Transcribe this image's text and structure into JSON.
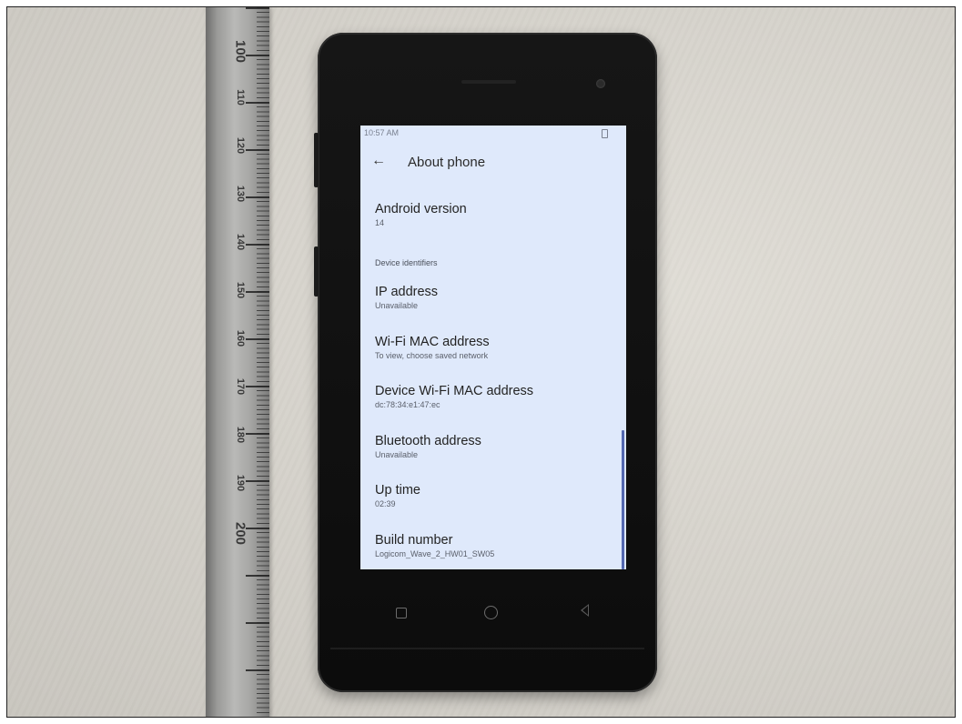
{
  "ruler": {
    "marks": [
      "100",
      "110",
      "120",
      "130",
      "140",
      "150",
      "160",
      "170",
      "180",
      "190",
      "200"
    ]
  },
  "status_bar": {
    "time": "10:57 AM",
    "battery_icon": "battery-icon"
  },
  "app_bar": {
    "title": "About phone",
    "back_icon": "arrow-left-icon"
  },
  "preferences": [
    {
      "title": "Android version",
      "summary": "14"
    },
    {
      "section": "Device identifiers"
    },
    {
      "title": "IP address",
      "summary": "Unavailable"
    },
    {
      "title": "Wi-Fi MAC address",
      "summary": "To view, choose saved network"
    },
    {
      "title": "Device Wi-Fi MAC address",
      "summary": "dc:78:34:e1:47:ec"
    },
    {
      "title": "Bluetooth address",
      "summary": "Unavailable"
    },
    {
      "title": "Up time",
      "summary": "02:39"
    },
    {
      "title": "Build number",
      "summary": "Logicom_Wave_2_HW01_SW05"
    }
  ],
  "navigation": [
    "recents-square-icon",
    "home-circle-icon",
    "back-triangle-icon"
  ],
  "colors": {
    "screen": "#dfe9fb",
    "scrollbar": "#5368b0",
    "phone_body": "#111111"
  }
}
